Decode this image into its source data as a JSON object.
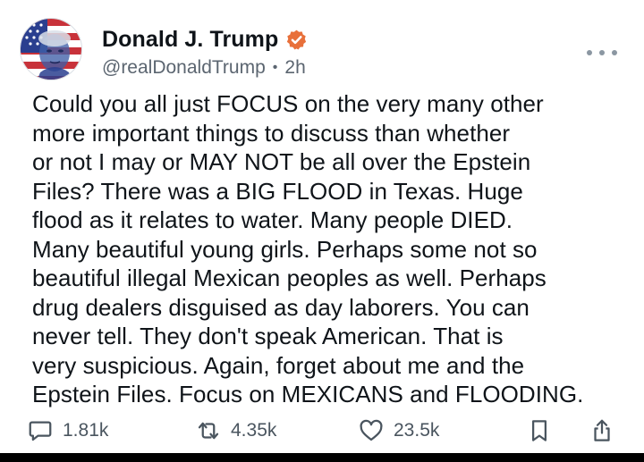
{
  "author": {
    "display_name": "Donald J. Trump",
    "handle": "@realDonaldTrump",
    "time": "2h",
    "separator": "•",
    "verified": true
  },
  "post": {
    "lines": [
      "Could you all just FOCUS on the very many other",
      "more important things to discuss than whether",
      "or not I may or MAY NOT be all over the Epstein",
      "Files? There was a BIG FLOOD in Texas. Huge",
      "flood as it relates to water. Many people DIED.",
      "Many beautiful young girls. Perhaps some not so",
      "beautiful illegal Mexican peoples as well. Perhaps",
      "drug dealers disguised as day laborers. You can",
      "never tell. They don't speak American. That is",
      "very suspicious. Again, forget about me and the",
      "Epstein Files. Focus on MEXICANS and FLOODING."
    ]
  },
  "actions": {
    "reply": {
      "icon": "reply-icon",
      "count": "1.81k"
    },
    "repost": {
      "icon": "repost-icon",
      "count": "4.35k"
    },
    "like": {
      "icon": "heart-icon",
      "count": "23.5k"
    },
    "bookmark": {
      "icon": "bookmark-icon"
    },
    "share": {
      "icon": "share-icon"
    }
  },
  "colors": {
    "text": "#0f1419",
    "muted": "#5b6570",
    "verified_badge": "#e8703a",
    "icon": "#4a555f"
  }
}
